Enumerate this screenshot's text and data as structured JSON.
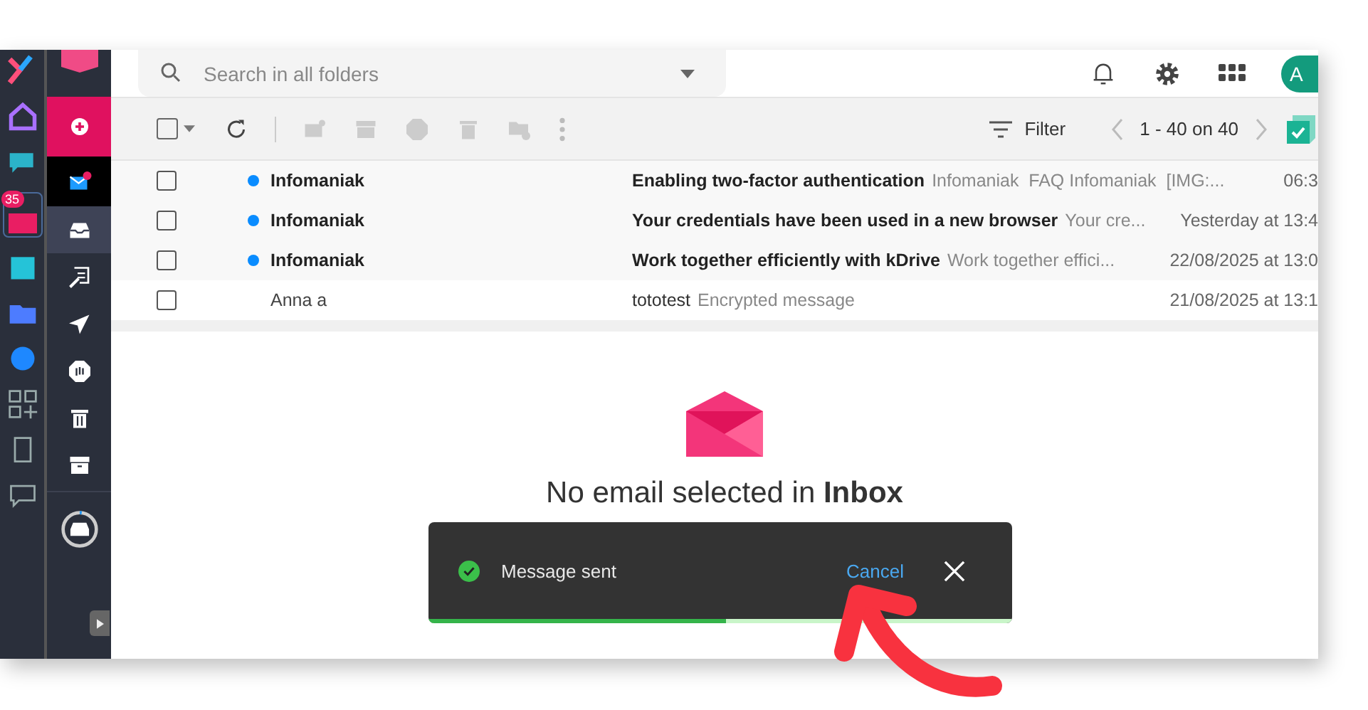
{
  "app_rail": {
    "badge": "35"
  },
  "folder_rail": {
    "items": [
      {
        "kind": "compose",
        "selected": false
      },
      {
        "kind": "mail",
        "selected": false
      },
      {
        "kind": "inbox",
        "selected": true
      },
      {
        "kind": "drafts",
        "selected": false
      },
      {
        "kind": "sent",
        "selected": false
      },
      {
        "kind": "spam",
        "selected": false
      },
      {
        "kind": "trash",
        "selected": false
      },
      {
        "kind": "archive",
        "selected": false
      }
    ]
  },
  "search": {
    "placeholder": "Search in all folders"
  },
  "header": {
    "avatar": "A"
  },
  "toolbar": {
    "select_all_checked": false,
    "filter": "Filter",
    "pagination": "1 - 40 on 40"
  },
  "messages": [
    {
      "sender": "Infomaniak",
      "unread": true,
      "checked": false,
      "subject": "Enabling two-factor authentication",
      "preview": "Infomaniak  FAQ Infomaniak  [IMG:...",
      "date": "06:3"
    },
    {
      "sender": "Infomaniak",
      "unread": true,
      "checked": false,
      "subject": "Your credentials have been used in a new browser",
      "preview": "Your cre...",
      "date": "Yesterday at 13:4"
    },
    {
      "sender": "Infomaniak",
      "unread": true,
      "checked": false,
      "subject": "Work together efficiently with kDrive",
      "preview": "Work together effici...",
      "date": "22/08/2025 at 13:0"
    },
    {
      "sender": "Anna a",
      "unread": false,
      "checked": false,
      "subject": "tototest",
      "preview": "Encrypted message",
      "date": "21/08/2025 at 13:1"
    }
  ],
  "reading_pane": {
    "message": "No email selected in **Inbox**"
  },
  "toast": {
    "text": "Message sent",
    "action": "Cancel",
    "level": 0.51
  }
}
